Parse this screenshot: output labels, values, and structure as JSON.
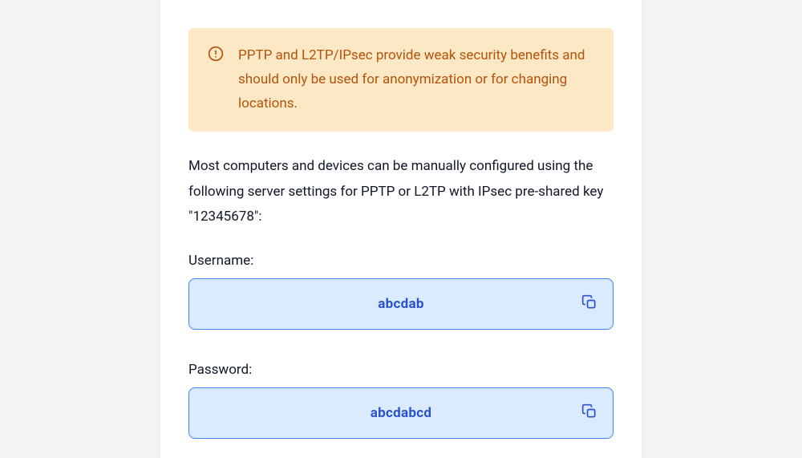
{
  "alert": {
    "text": "PPTP and L2TP/IPsec provide weak security benefits and should only be used for anonymization or for changing locations."
  },
  "description": "Most computers and devices can be manually configured using the following server settings for PPTP or L2TP with IPsec pre-shared key \"12345678\":",
  "fields": {
    "username": {
      "label": "Username:",
      "value": "abcdab"
    },
    "password": {
      "label": "Password:",
      "value": "abcdabcd"
    }
  }
}
